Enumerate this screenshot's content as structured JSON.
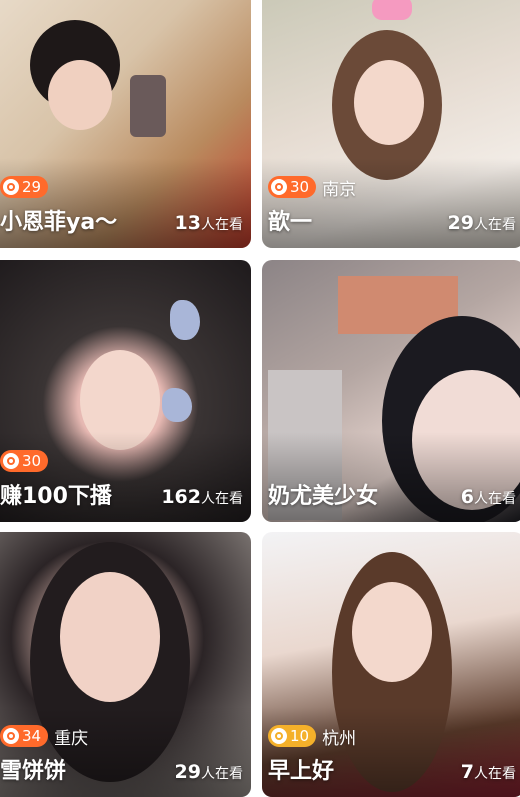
{
  "colors": {
    "level_badge": "#ff6a2b",
    "level_badge_gold": "#f4b02a"
  },
  "cards": [
    {
      "level": "29",
      "level_style": "orange",
      "city": "",
      "name": "小恩菲ya～",
      "viewers": "13",
      "viewers_label": "人在看"
    },
    {
      "level": "30",
      "level_style": "orange",
      "city": "南京",
      "name": "歆一",
      "viewers": "29",
      "viewers_label": "人在看"
    },
    {
      "level": "30",
      "level_style": "orange",
      "city": "",
      "name": "赚100下播",
      "viewers": "162",
      "viewers_label": "人在看"
    },
    {
      "level": "",
      "level_style": "",
      "city": "",
      "name": "奶尤美少女",
      "viewers": "6",
      "viewers_label": "人在看"
    },
    {
      "level": "34",
      "level_style": "orange",
      "city": "重庆",
      "name": "雪饼饼",
      "viewers": "29",
      "viewers_label": "人在看"
    },
    {
      "level": "10",
      "level_style": "gold",
      "city": "杭州",
      "name": "早上好",
      "viewers": "7",
      "viewers_label": "人在看"
    }
  ]
}
